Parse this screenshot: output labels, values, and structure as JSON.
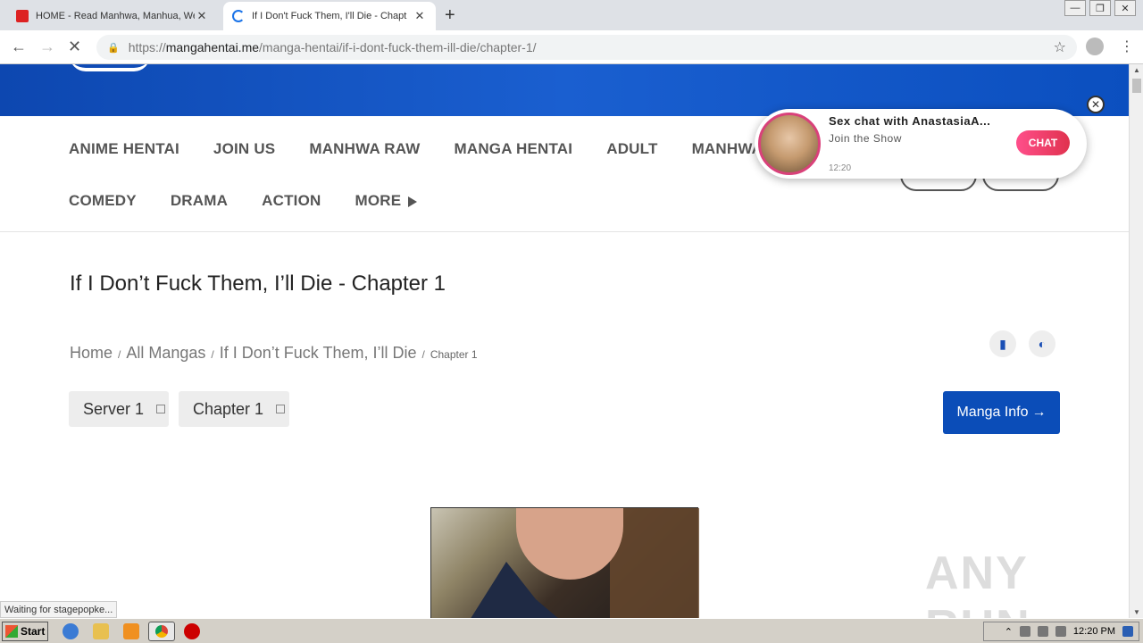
{
  "browser": {
    "tabs": [
      {
        "title": "HOME - Read Manhwa, Manhua, We",
        "active": false
      },
      {
        "title": "If I Don't Fuck Them, I'll Die - Chapt",
        "active": true
      }
    ],
    "url_scheme": "https://",
    "url_host": "mangahentai.me",
    "url_path": "/manga-hentai/if-i-dont-fuck-them-ill-die/chapter-1/",
    "status_text": "Waiting for stagepopke..."
  },
  "nav": {
    "row1": [
      "ANIME HENTAI",
      "JOIN US",
      "MANHWA RAW",
      "MANGA HENTAI",
      "ADULT",
      "MANHWA"
    ],
    "row2": [
      "COMEDY",
      "DRAMA",
      "ACTION",
      "MORE"
    ]
  },
  "chapter": {
    "title": "If I Don’t Fuck Them, I’ll Die - Chapter 1",
    "breadcrumb": {
      "home": "Home",
      "all": "All Mangas",
      "series": "If I Don’t Fuck Them, I’ll Die",
      "current": "Chapter 1",
      "sep": "/"
    },
    "server_select": "Server 1",
    "chapter_select": "Chapter 1",
    "info_button": "Manga Info"
  },
  "popup": {
    "name": "Sex chat with AnastasiaA...",
    "subtitle": "Join the Show",
    "time": "12:20",
    "chat_label": "CHAT",
    "close": "✕"
  },
  "watermark": "ANY RUN",
  "taskbar": {
    "start": "Start",
    "clock": "12:20 PM"
  },
  "colors": {
    "brand_blue": "#0b4db8",
    "popup_chat": "#e0324e"
  }
}
